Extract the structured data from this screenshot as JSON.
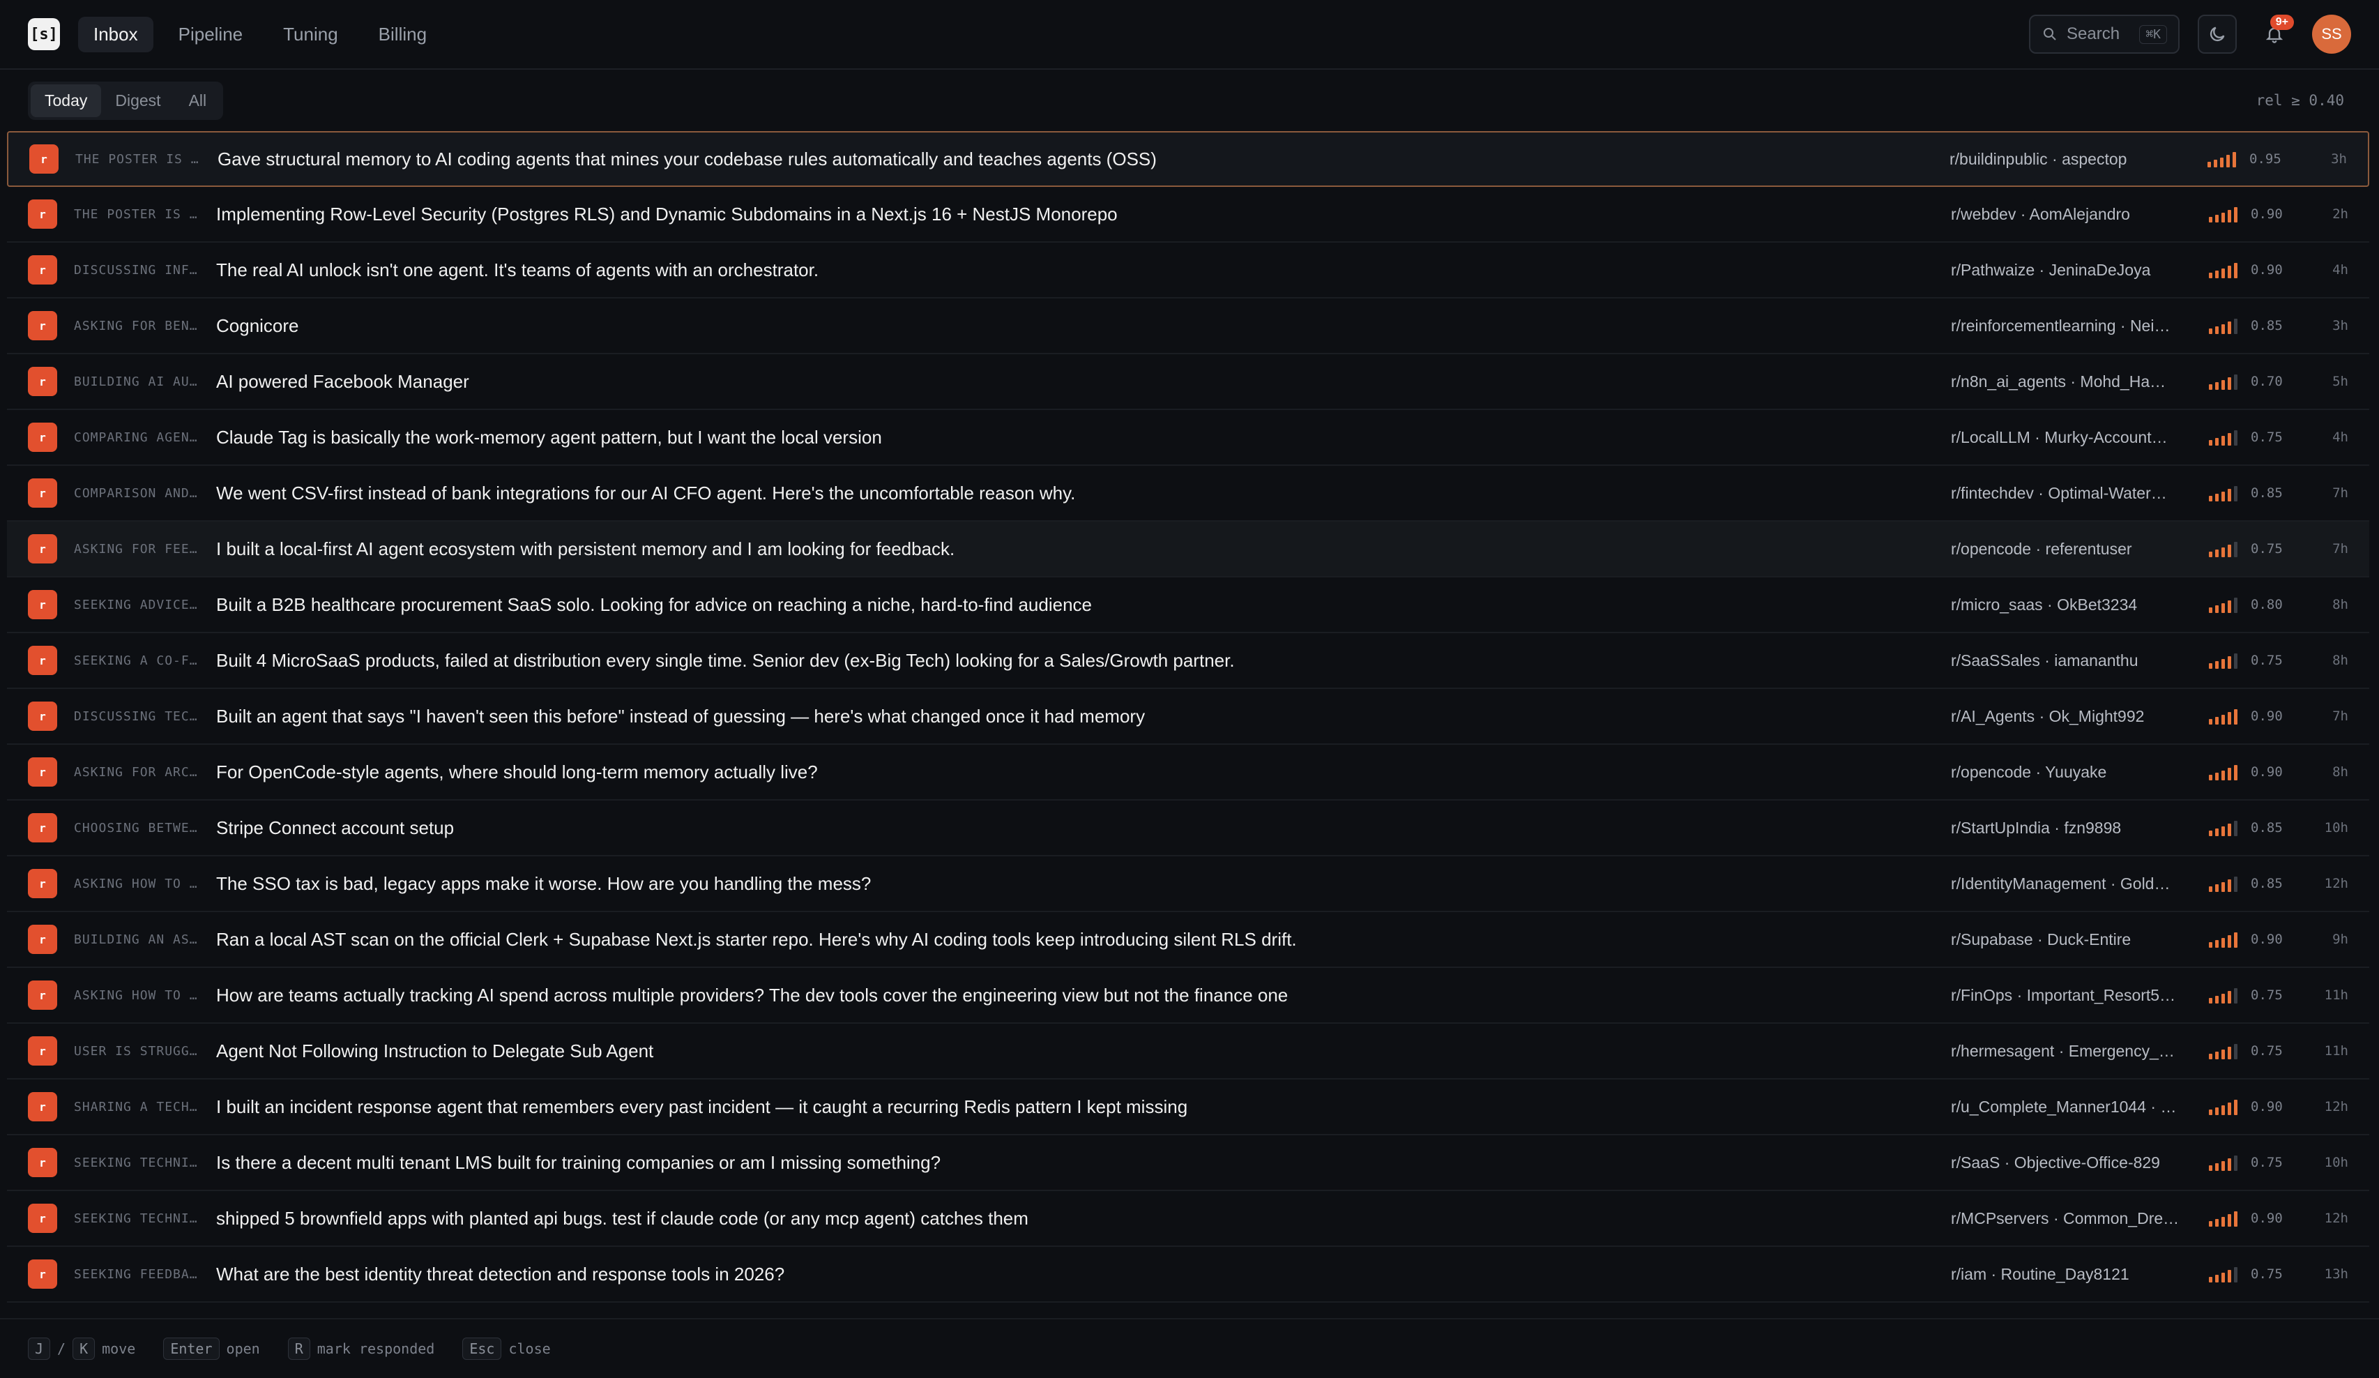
{
  "app": {
    "logo_text": "[s]",
    "nav": [
      {
        "label": "Inbox",
        "active": true
      },
      {
        "label": "Pipeline"
      },
      {
        "label": "Tuning"
      },
      {
        "label": "Billing"
      }
    ],
    "search": {
      "label": "Search",
      "shortcut": "⌘K"
    },
    "notifications_badge": "9+",
    "avatar": "SS"
  },
  "filters": {
    "tabs": [
      {
        "label": "Today",
        "active": true
      },
      {
        "label": "Digest"
      },
      {
        "label": "All"
      }
    ],
    "threshold": "rel ≥ 0.40"
  },
  "rows": [
    {
      "source": "r",
      "tag": "THE POSTER IS …",
      "title": "Gave structural memory to AI coding agents that mines your codebase rules automatically and teaches agents (OSS)",
      "meta": "r/buildinpublic · aspectop",
      "score": "0.95",
      "bars": 5,
      "age": "3h",
      "selected": true
    },
    {
      "source": "r",
      "tag": "THE POSTER IS …",
      "title": "Implementing Row-Level Security (Postgres RLS) and Dynamic Subdomains in a Next.js 16 + NestJS Monorepo",
      "meta": "r/webdev · AomAlejandro",
      "score": "0.90",
      "bars": 5,
      "age": "2h"
    },
    {
      "source": "r",
      "tag": "DISCUSSING INF…",
      "title": "The real AI unlock isn't one agent. It's teams of agents with an orchestrator.",
      "meta": "r/Pathwaize · JeninaDeJoya",
      "score": "0.90",
      "bars": 5,
      "age": "4h"
    },
    {
      "source": "r",
      "tag": "ASKING FOR BEN…",
      "title": "Cognicore",
      "meta": "r/reinforcementlearning · Nei…",
      "score": "0.85",
      "bars": 4,
      "age": "3h"
    },
    {
      "source": "r",
      "tag": "BUILDING AI AU…",
      "title": "AI powered Facebook Manager",
      "meta": "r/n8n_ai_agents · Mohd_Ha…",
      "score": "0.70",
      "bars": 4,
      "age": "5h"
    },
    {
      "source": "r",
      "tag": "COMPARING AGEN…",
      "title": "Claude Tag is basically the work-memory agent pattern, but I want the local version",
      "meta": "r/LocalLLM · Murky-Account…",
      "score": "0.75",
      "bars": 4,
      "age": "4h"
    },
    {
      "source": "r",
      "tag": "COMPARISON AND…",
      "title": "We went CSV-first instead of bank integrations for our AI CFO agent. Here's the uncomfortable reason why.",
      "meta": "r/fintechdev · Optimal-Water…",
      "score": "0.85",
      "bars": 4,
      "age": "7h"
    },
    {
      "source": "r",
      "tag": "ASKING FOR FEE…",
      "title": "I built a local-first AI agent ecosystem with persistent memory and I am looking for feedback.",
      "meta": "r/opencode · referentuser",
      "score": "0.75",
      "bars": 4,
      "age": "7h",
      "hover": true
    },
    {
      "source": "r",
      "tag": "SEEKING ADVICE…",
      "title": "Built a B2B healthcare procurement SaaS solo. Looking for advice on reaching a niche, hard-to-find audience",
      "meta": "r/micro_saas · OkBet3234",
      "score": "0.80",
      "bars": 4,
      "age": "8h"
    },
    {
      "source": "r",
      "tag": "SEEKING A CO-F…",
      "title": "Built 4 MicroSaaS products, failed at distribution every single time. Senior dev (ex-Big Tech) looking for a Sales/Growth partner.",
      "meta": "r/SaaSSales · iamananthu",
      "score": "0.75",
      "bars": 4,
      "age": "8h"
    },
    {
      "source": "r",
      "tag": "DISCUSSING TEC…",
      "title": "Built an agent that says \"I haven't seen this before\" instead of guessing — here's what changed once it had memory",
      "meta": "r/AI_Agents · Ok_Might992",
      "score": "0.90",
      "bars": 5,
      "age": "7h"
    },
    {
      "source": "r",
      "tag": "ASKING FOR ARC…",
      "title": "For OpenCode-style agents, where should long-term memory actually live?",
      "meta": "r/opencode · Yuuyake",
      "score": "0.90",
      "bars": 5,
      "age": "8h"
    },
    {
      "source": "r",
      "tag": "CHOOSING BETWE…",
      "title": "Stripe Connect account setup",
      "meta": "r/StartUpIndia · fzn9898",
      "score": "0.85",
      "bars": 4,
      "age": "10h"
    },
    {
      "source": "r",
      "tag": "ASKING HOW TO …",
      "title": "The SSO tax is bad, legacy apps make it worse. How are you handling the mess?",
      "meta": "r/IdentityManagement · Gold…",
      "score": "0.85",
      "bars": 4,
      "age": "12h"
    },
    {
      "source": "r",
      "tag": "BUILDING AN AS…",
      "title": "Ran a local AST scan on the official Clerk + Supabase Next.js starter repo. Here's why AI coding tools keep introducing silent RLS drift.",
      "meta": "r/Supabase · Duck-Entire",
      "score": "0.90",
      "bars": 5,
      "age": "9h"
    },
    {
      "source": "r",
      "tag": "ASKING HOW TO …",
      "title": "How are teams actually tracking AI spend across multiple providers? The dev tools cover the engineering view but not the finance one",
      "meta": "r/FinOps · Important_Resort5…",
      "score": "0.75",
      "bars": 4,
      "age": "11h"
    },
    {
      "source": "r",
      "tag": "USER IS STRUGG…",
      "title": "Agent Not Following Instruction to Delegate Sub Agent",
      "meta": "r/hermesagent · Emergency_…",
      "score": "0.75",
      "bars": 4,
      "age": "11h"
    },
    {
      "source": "r",
      "tag": "SHARING A TECH…",
      "title": "I built an incident response agent that remembers every past incident — it caught a recurring Redis pattern I kept missing",
      "meta": "r/u_Complete_Manner1044 · …",
      "score": "0.90",
      "bars": 5,
      "age": "12h"
    },
    {
      "source": "r",
      "tag": "SEEKING TECHNI…",
      "title": "Is there a decent multi tenant LMS built for training companies or am I missing something?",
      "meta": "r/SaaS · Objective-Office-829",
      "score": "0.75",
      "bars": 4,
      "age": "10h"
    },
    {
      "source": "r",
      "tag": "SEEKING TECHNI…",
      "title": "shipped 5 brownfield apps with planted api bugs. test if claude code (or any mcp agent) catches them",
      "meta": "r/MCPservers · Common_Dre…",
      "score": "0.90",
      "bars": 5,
      "age": "12h"
    },
    {
      "source": "r",
      "tag": "SEEKING FEEDBA…",
      "title": "What are the best identity threat detection and response tools in 2026?",
      "meta": "r/iam · Routine_Day8121",
      "score": "0.75",
      "bars": 4,
      "age": "13h"
    }
  ],
  "footer": {
    "key_j": "J",
    "slash": "/",
    "key_k": "K",
    "move": "move",
    "key_enter": "Enter",
    "open": "open",
    "key_r": "R",
    "mark": "mark responded",
    "key_esc": "Esc",
    "close": "close"
  }
}
